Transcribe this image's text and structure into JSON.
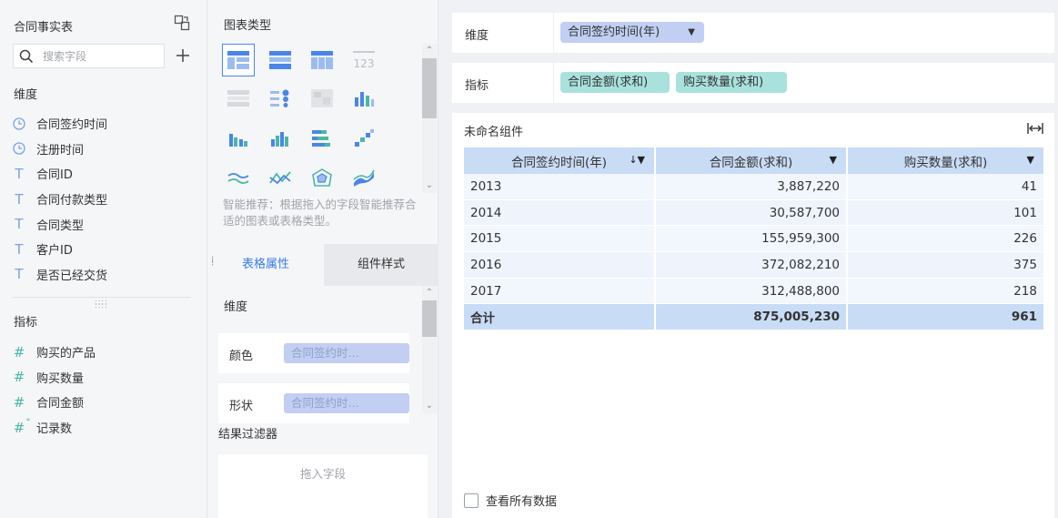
{
  "left": {
    "title": "合同事实表",
    "search_placeholder": "搜索字段",
    "dimension_header": "维度",
    "dimensions": [
      {
        "label": "合同签约时间",
        "icon": "clock-icon"
      },
      {
        "label": "注册时间",
        "icon": "clock-icon"
      },
      {
        "label": "合同ID",
        "icon": "text-type-icon"
      },
      {
        "label": "合同付款类型",
        "icon": "text-type-icon"
      },
      {
        "label": "合同类型",
        "icon": "text-type-icon"
      },
      {
        "label": "客户ID",
        "icon": "text-type-icon"
      },
      {
        "label": "是否已经交货",
        "icon": "text-type-icon"
      }
    ],
    "measure_header": "指标",
    "measures": [
      {
        "label": "购买的产品",
        "icon": "number-type-icon"
      },
      {
        "label": "购买数量",
        "icon": "number-type-icon"
      },
      {
        "label": "合同金额",
        "icon": "number-type-icon"
      },
      {
        "label": "记录数",
        "icon": "number-calc-icon"
      }
    ]
  },
  "middle": {
    "chart_type_title": "图表类型",
    "recommend_hint": "智能推荐：根据拖入的字段智能推荐合适的图表或表格类型。",
    "tabs": {
      "table_props": "表格属性",
      "component_style": "组件样式"
    },
    "dimension_label": "维度",
    "color_label": "颜色",
    "color_field": "合同签约时…",
    "shape_label": "形状",
    "shape_field": "合同签约时…",
    "filter_title": "结果过滤器",
    "filter_placeholder": "拖入字段"
  },
  "right": {
    "dimension_well_label": "维度",
    "dimension_chip": "合同签约时间(年)",
    "measure_well_label": "指标",
    "measure_chips": [
      "合同金额(求和)",
      "购买数量(求和)"
    ],
    "widget_title": "未命名组件",
    "table": {
      "columns": [
        "合同签约时间(年)",
        "合同金额(求和)",
        "购买数量(求和)"
      ],
      "rows": [
        [
          "2013",
          "3,887,220",
          "41"
        ],
        [
          "2014",
          "30,587,700",
          "101"
        ],
        [
          "2015",
          "155,959,300",
          "226"
        ],
        [
          "2016",
          "372,082,210",
          "375"
        ],
        [
          "2017",
          "312,488,800",
          "218"
        ]
      ],
      "total": [
        "合计",
        "875,005,230",
        "961"
      ]
    },
    "view_all_label": "查看所有数据"
  },
  "colors": {
    "accent": "#3b7be9",
    "dimension_chip": "#c2cff3",
    "measure_chip": "#a9e2dc",
    "table_header": "#c9dcf6"
  }
}
